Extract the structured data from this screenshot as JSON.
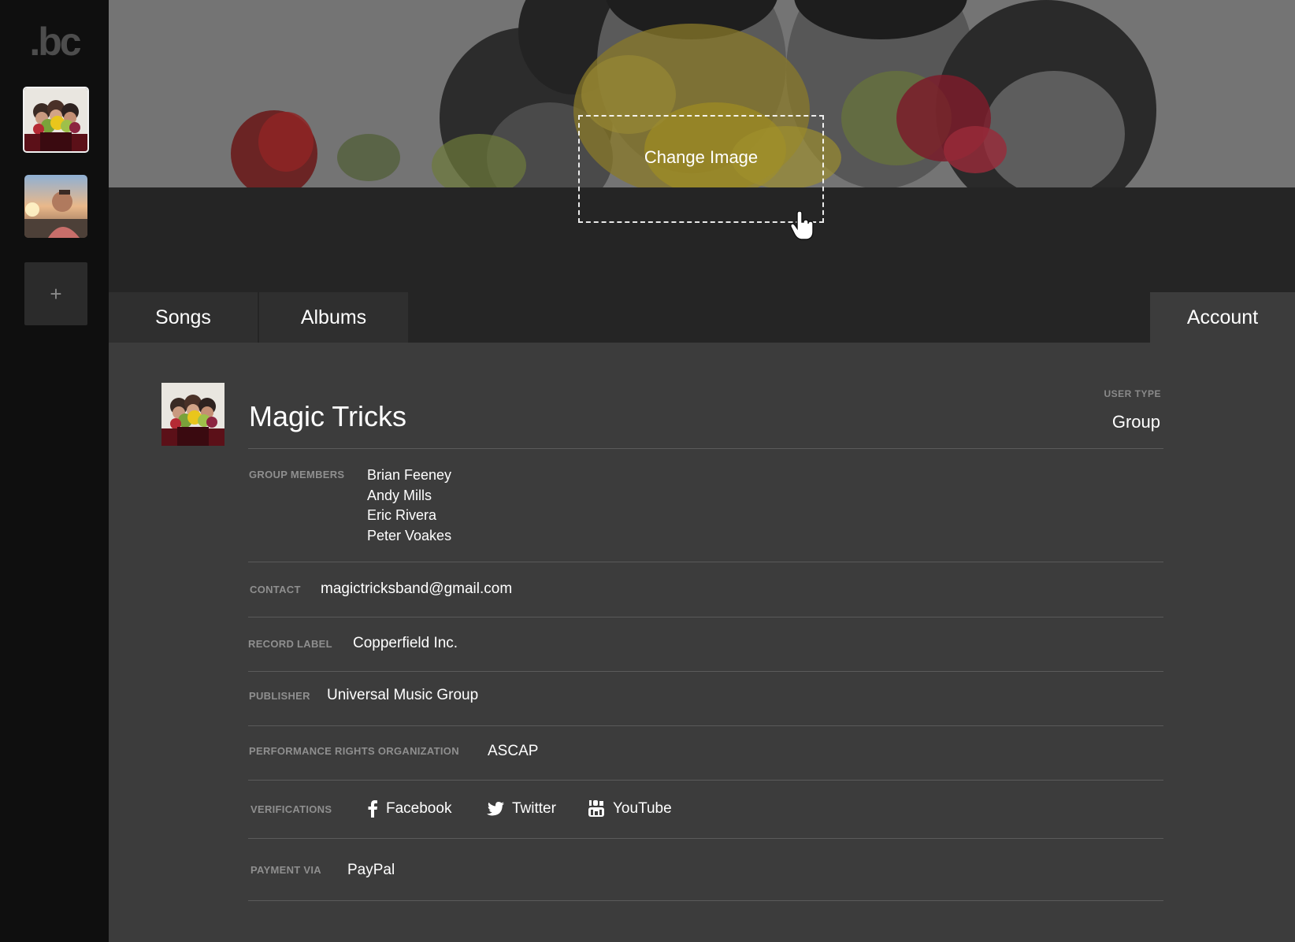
{
  "sidebar": {
    "logo": ".bc",
    "add_label": "+"
  },
  "header": {
    "change_image_label": "Change Image"
  },
  "tabs": {
    "songs": "Songs",
    "albums": "Albums",
    "account": "Account"
  },
  "account": {
    "name": "Magic Tricks",
    "user_type_label": "USER TYPE",
    "user_type": "Group",
    "group_members_label": "GROUP MEMBERS",
    "members": [
      "Brian Feeney",
      "Andy Mills",
      "Eric Rivera",
      "Peter Voakes"
    ],
    "contact_label": "CONTACT",
    "contact": "magictricksband@gmail.com",
    "record_label_label": "RECORD LABEL",
    "record_label": "Copperfield Inc.",
    "publisher_label": "PUBLISHER",
    "publisher": "Universal Music Group",
    "pro_label": "PERFORMANCE RIGHTS ORGANIZATION",
    "pro": "ASCAP",
    "verifications_label": "VERIFICATIONS",
    "verifications": {
      "facebook": "Facebook",
      "twitter": "Twitter",
      "youtube": "YouTube"
    },
    "payment_label": "PAYMENT VIA",
    "payment": "PayPal"
  },
  "icons": {
    "facebook": "facebook-icon",
    "twitter": "twitter-icon",
    "youtube": "youtube-icon",
    "cursor": "hand-pointer-icon"
  },
  "colors": {
    "sidebar_bg": "#0f0f0f",
    "content_bg": "#3c3c3c",
    "tab_bar_bg": "#252525",
    "label_gray": "#8f8f8f",
    "divider": "#5a5a5a"
  }
}
